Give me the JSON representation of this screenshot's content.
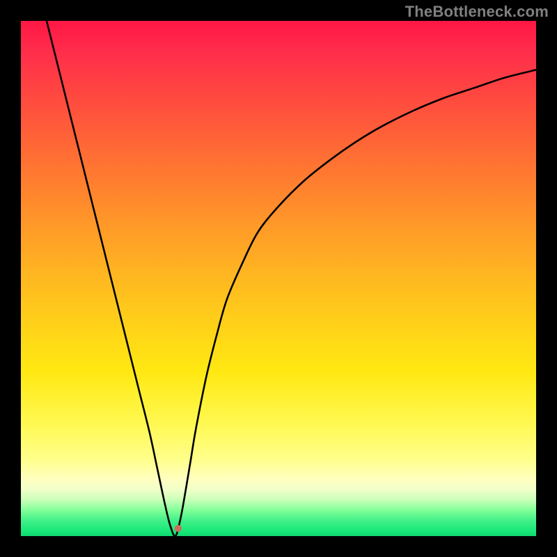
{
  "watermark": "TheBottleneck.com",
  "chart_data": {
    "type": "line",
    "title": "",
    "xlabel": "",
    "ylabel": "",
    "xlim": [
      0,
      100
    ],
    "ylim": [
      0,
      100
    ],
    "vertex_x": 30,
    "marker": {
      "x": 30.5,
      "y": 1.5,
      "color": "#d06a5a",
      "radius": 5
    },
    "series": [
      {
        "name": "left-branch",
        "x": [
          5,
          7,
          9,
          11,
          13,
          15,
          17,
          19,
          21,
          23,
          25,
          26.5,
          28,
          29,
          30
        ],
        "values": [
          100,
          92,
          84,
          76,
          68,
          60,
          52,
          44,
          36,
          28,
          20,
          13,
          6,
          2,
          0
        ]
      },
      {
        "name": "right-branch",
        "x": [
          30,
          31,
          32,
          33,
          34,
          36,
          38,
          40,
          43,
          46,
          50,
          55,
          60,
          65,
          70,
          76,
          82,
          88,
          94,
          100
        ],
        "values": [
          0,
          3.5,
          9,
          15,
          21,
          31,
          39,
          46,
          53,
          59,
          64,
          69,
          73,
          76.5,
          79.5,
          82.5,
          85,
          87,
          89,
          90.5
        ]
      }
    ],
    "gradient_stops": [
      {
        "pos": 0,
        "color": "#ff1744"
      },
      {
        "pos": 6,
        "color": "#ff2d4b"
      },
      {
        "pos": 12,
        "color": "#ff4043"
      },
      {
        "pos": 20,
        "color": "#ff5a3a"
      },
      {
        "pos": 30,
        "color": "#ff7a30"
      },
      {
        "pos": 40,
        "color": "#ff9a28"
      },
      {
        "pos": 50,
        "color": "#ffb820"
      },
      {
        "pos": 60,
        "color": "#ffd418"
      },
      {
        "pos": 68,
        "color": "#ffe812"
      },
      {
        "pos": 78,
        "color": "#fff850"
      },
      {
        "pos": 85,
        "color": "#ffff8a"
      },
      {
        "pos": 89,
        "color": "#ffffc0"
      },
      {
        "pos": 91,
        "color": "#f0ffc8"
      },
      {
        "pos": 93,
        "color": "#c8ffb8"
      },
      {
        "pos": 95,
        "color": "#80ff98"
      },
      {
        "pos": 97,
        "color": "#40f088"
      },
      {
        "pos": 99,
        "color": "#18e878"
      },
      {
        "pos": 100,
        "color": "#10d870"
      }
    ]
  }
}
